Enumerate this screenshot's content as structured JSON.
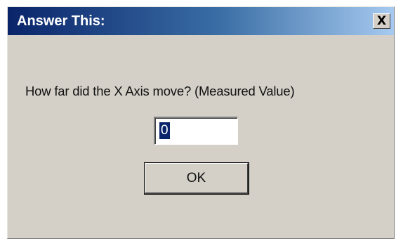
{
  "dialog": {
    "title": "Answer This:",
    "close_glyph": "X",
    "prompt": "How far did the X Axis move? (Measured Value)",
    "input_value": "0",
    "ok_label": "OK"
  },
  "colors": {
    "title_bar_start": "#0a246a",
    "title_bar_end": "#a6caf0",
    "dialog_background": "#d4d0c8",
    "selection": "#0a246a"
  },
  "icons": {
    "close": "close-icon"
  }
}
